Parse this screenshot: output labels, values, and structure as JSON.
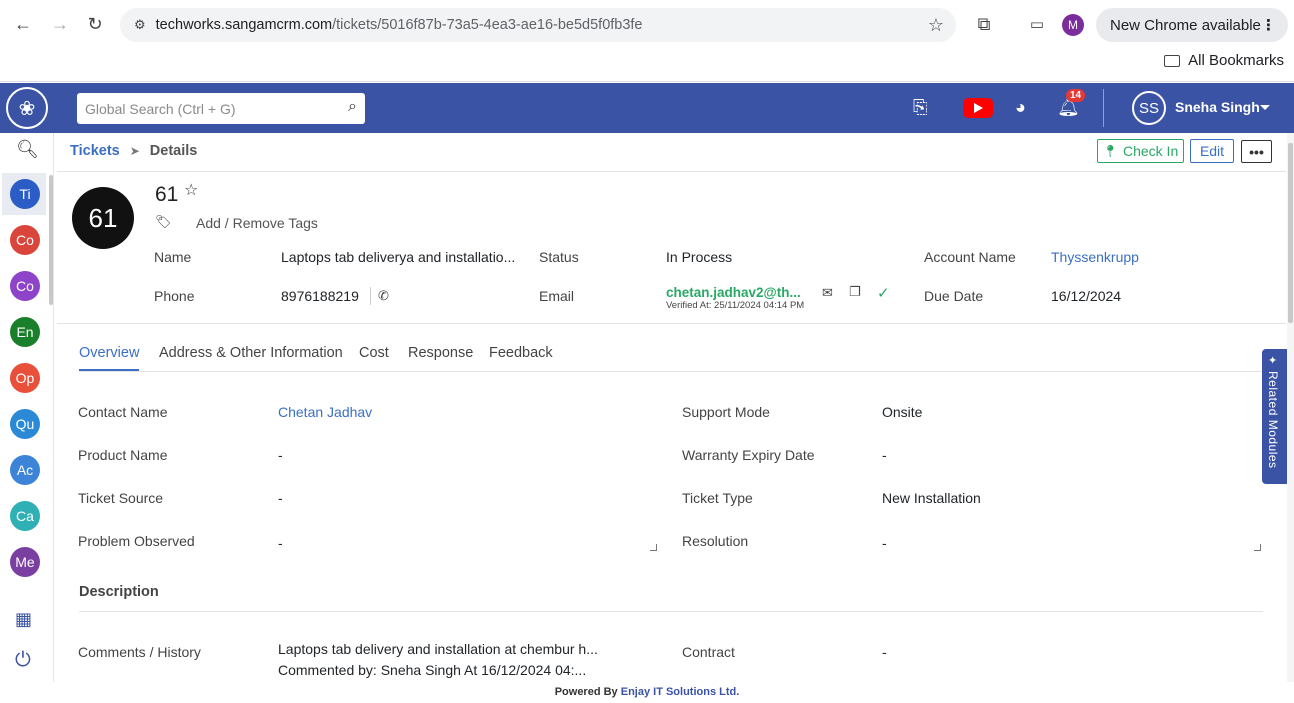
{
  "browser": {
    "url_host": "techworks.sangamcrm.com",
    "url_path": "/tickets/5016f87b-73a5-4ea3-ae16-be5d5f0fb3fe",
    "profile_initial": "M",
    "update_label": "New Chrome available",
    "bookmarks_label": "All Bookmarks"
  },
  "header": {
    "search_placeholder": "Global Search (Ctrl + G)",
    "notification_count": "14",
    "user_initials": "SS",
    "user_name": "Sneha Singh"
  },
  "sidebar": {
    "items": [
      {
        "label": "Ti",
        "color": "#2c5cc5"
      },
      {
        "label": "Co",
        "color": "#d9443b"
      },
      {
        "label": "Co",
        "color": "#8e44c9"
      },
      {
        "label": "En",
        "color": "#1a7f2a"
      },
      {
        "label": "Op",
        "color": "#e8503a"
      },
      {
        "label": "Qu",
        "color": "#2b8ad6"
      },
      {
        "label": "Ac",
        "color": "#3d84d8"
      },
      {
        "label": "Ca",
        "color": "#2eb0b5"
      },
      {
        "label": "Me",
        "color": "#7a3fa0"
      }
    ]
  },
  "breadcrumb": {
    "parent": "Tickets",
    "separator": "➤",
    "current": "Details"
  },
  "actions": {
    "check_in": "Check In",
    "edit": "Edit",
    "more": "•••"
  },
  "ticket": {
    "number_badge": "61",
    "number": "61",
    "tags_label": "Add / Remove Tags",
    "fields": {
      "name_label": "Name",
      "name_value": "Laptops tab deliverya and installatio...",
      "status_label": "Status",
      "status_value": "In Process",
      "account_label": "Account Name",
      "account_value": "Thyssenkrupp",
      "phone_label": "Phone",
      "phone_value": "8976188219",
      "email_label": "Email",
      "email_value": "chetan.jadhav2@th...",
      "email_verified": "Verified At: 25/11/2024 04:14 PM",
      "due_label": "Due Date",
      "due_value": "16/12/2024"
    }
  },
  "tabs": [
    "Overview",
    "Address & Other Information",
    "Cost",
    "Response",
    "Feedback"
  ],
  "overview": {
    "contact_name_label": "Contact Name",
    "contact_name_value": "Chetan Jadhav",
    "support_mode_label": "Support Mode",
    "support_mode_value": "Onsite",
    "product_name_label": "Product Name",
    "product_name_value": "-",
    "warranty_label": "Warranty Expiry Date",
    "warranty_value": "-",
    "ticket_source_label": "Ticket Source",
    "ticket_source_value": "-",
    "ticket_type_label": "Ticket Type",
    "ticket_type_value": "New Installation",
    "problem_label": "Problem Observed",
    "problem_value": "-",
    "resolution_label": "Resolution",
    "resolution_value": "-",
    "description_title": "Description",
    "comments_label": "Comments / History",
    "comments_line1": "Laptops tab delivery and installation at chembur h...",
    "comments_line2": "Commented by: Sneha Singh At 16/12/2024 04:...",
    "contract_label": "Contract",
    "contract_value": "-"
  },
  "related_modules": "Related Modules",
  "footer": {
    "prefix": "Powered By",
    "brand": "Enjay IT Solutions Ltd."
  }
}
